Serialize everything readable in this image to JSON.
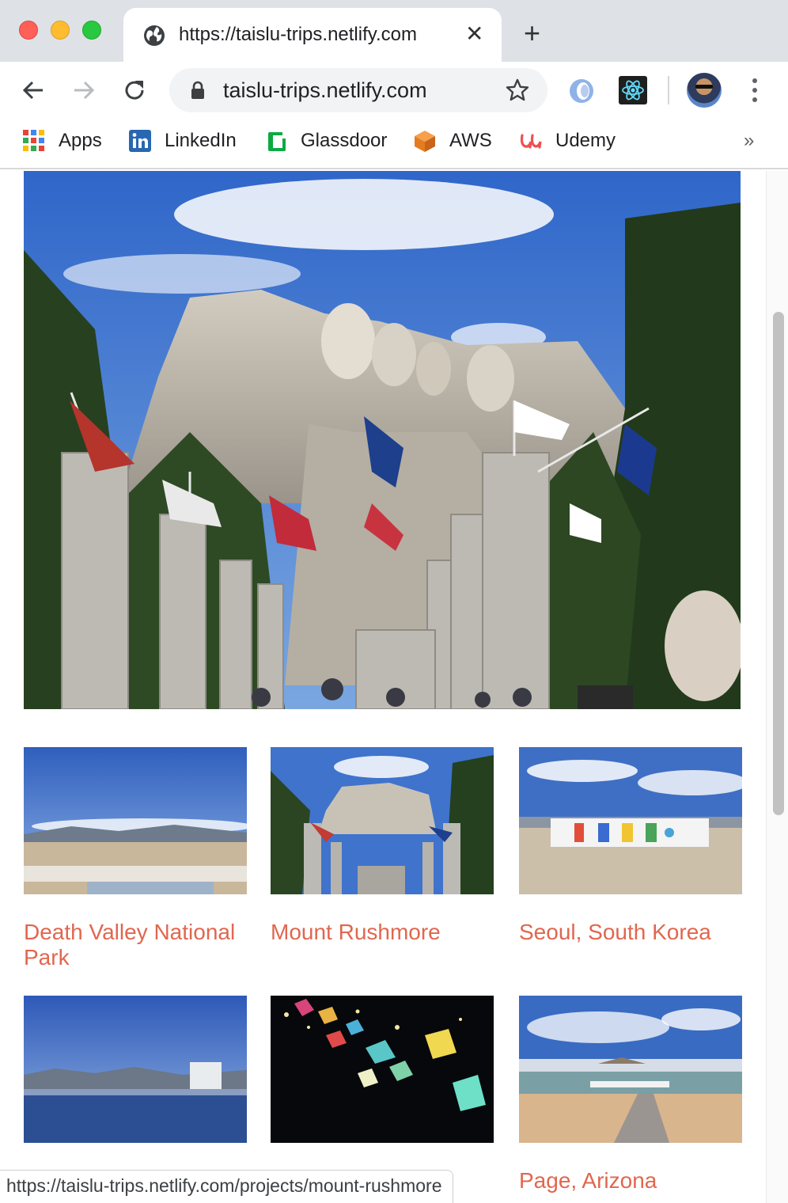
{
  "browser": {
    "tab_title": "https://taislu-trips.netlify.com",
    "address": "taislu-trips.netlify.com",
    "bookmarks": [
      "Apps",
      "LinkedIn",
      "Glassdoor",
      "AWS",
      "Udemy"
    ],
    "more_bookmarks": "»"
  },
  "page": {
    "hero_image": "mount-rushmore-photo",
    "projects": [
      {
        "title": "Death Valley National Park",
        "image": "death-valley-photo"
      },
      {
        "title": "Mount Rushmore",
        "image": "mount-rushmore-photo"
      },
      {
        "title": "Seoul, South Korea",
        "image": "seoul-sign-photo"
      },
      {
        "title": "",
        "image": "lake-skyline-photo"
      },
      {
        "title": "",
        "image": "lanterns-night-photo"
      },
      {
        "title": "Page, Arizona",
        "image": "lake-powell-marina-photo"
      }
    ],
    "accent_color": "#e0674f"
  },
  "status_bar": {
    "hover_url": "https://taislu-trips.netlify.com/projects/mount-rushmore"
  }
}
